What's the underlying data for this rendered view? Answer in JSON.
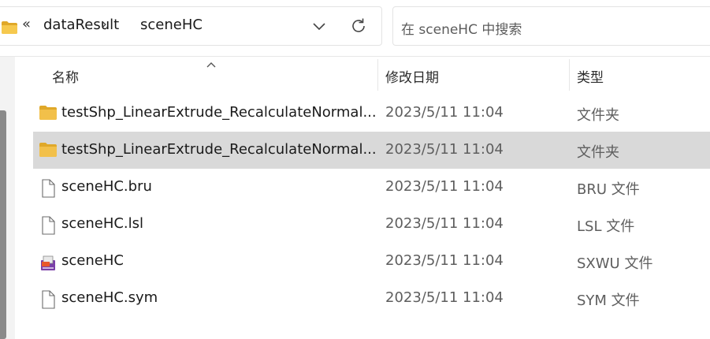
{
  "address_bar": {
    "overflow_symbol": "«",
    "breadcrumbs": [
      "dataResult",
      "sceneHC"
    ],
    "separator": "›",
    "folder_icon": "folder-icon",
    "dropdown_icon": "chevron-down-icon",
    "refresh_icon": "refresh-icon"
  },
  "search": {
    "placeholder": "在 sceneHC 中搜索"
  },
  "columns": {
    "name": "名称",
    "date": "修改日期",
    "type": "类型"
  },
  "files": [
    {
      "name": "testShp_LinearExtrude_RecalculateNormal...",
      "date": "2023/5/11 11:04",
      "type": "文件夹",
      "icon": "folder-icon",
      "selected": false
    },
    {
      "name": "testShp_LinearExtrude_RecalculateNormal...",
      "date": "2023/5/11 11:04",
      "type": "文件夹",
      "icon": "folder-icon",
      "selected": true
    },
    {
      "name": "sceneHC.bru",
      "date": "2023/5/11 11:04",
      "type": "BRU 文件",
      "icon": "file-icon",
      "selected": false
    },
    {
      "name": "sceneHC.lsl",
      "date": "2023/5/11 11:04",
      "type": "LSL 文件",
      "icon": "file-icon",
      "selected": false
    },
    {
      "name": "sceneHC",
      "date": "2023/5/11 11:04",
      "type": "SXWU 文件",
      "icon": "sxwu-app-icon",
      "selected": false
    },
    {
      "name": "sceneHC.sym",
      "date": "2023/5/11 11:04",
      "type": "SYM 文件",
      "icon": "file-icon",
      "selected": false
    }
  ],
  "colors": {
    "selected_row": "#d9d9d9",
    "folder": "#f2c04a",
    "folder_dark": "#e0a829",
    "sxwu_accent": "#7a3fa8"
  }
}
